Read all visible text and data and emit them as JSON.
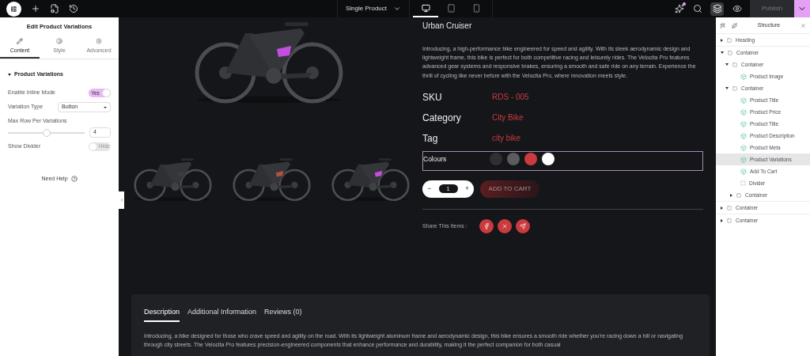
{
  "topbar": {
    "page_selector": "Single Product",
    "devices": [
      {
        "kind": "desktop",
        "selected": true
      },
      {
        "kind": "tablet",
        "selected": false
      },
      {
        "kind": "mobile",
        "selected": false
      }
    ],
    "publish": "Publish",
    "notification": true
  },
  "left_panel": {
    "title": "Edit Product Variations",
    "tabs": [
      {
        "label": "Content",
        "kind": "pencil",
        "selected": true
      },
      {
        "label": "Style",
        "kind": "contrast",
        "selected": false
      },
      {
        "label": "Advanced",
        "kind": "gear",
        "selected": false
      }
    ],
    "section": {
      "title": "Product Variations",
      "expanded": true
    },
    "controls": [
      {
        "kind": "switch",
        "label": "Enable Inline Mode",
        "on": true,
        "on_text": "Yes"
      },
      {
        "kind": "select",
        "label": "Variation Type",
        "value": "Button"
      },
      {
        "kind": "slider",
        "label": "Max Row Per Variations",
        "level": 0.5,
        "value": "4"
      },
      {
        "kind": "switch",
        "label": "Show Divider",
        "on": false,
        "off_text": "Hide"
      }
    ],
    "help": "Need Help"
  },
  "product": {
    "title": "Urban Cruiser",
    "description": "Introducing, a high-performance bike engineered for speed and agility. With its sleek aerodynamic design and lightweight frame, this bike is perfect for both competitive racing and leisurely rides. The Velocita Pro features advanced gear systems and responsive brakes, ensuring a smooth and safe ride on any terrain. Experience the thrill of cycling like never before with the Velocita Pro, where innovation meets style.",
    "meta": [
      {
        "label": "SKU",
        "value": "RDS - 005"
      },
      {
        "label": "Category",
        "value": "City Bike"
      },
      {
        "label": "Tag",
        "value": "city bike"
      }
    ],
    "colours": {
      "label": "Colours",
      "swatches": [
        {
          "color": "#2e3033"
        },
        {
          "color": "#5c5c5e"
        },
        {
          "color": "#c93b3e"
        },
        {
          "color": "#ffffff"
        }
      ]
    },
    "quantity": {
      "minus": "−",
      "value": "1",
      "plus": "+"
    },
    "add_to_cart": "ADD TO CART",
    "share": {
      "label": "Share This Items :",
      "networks": [
        {
          "kind": "facebook"
        },
        {
          "kind": "x"
        },
        {
          "kind": "telegram"
        }
      ]
    }
  },
  "info_tabs": {
    "tabs": [
      {
        "label": "Description",
        "selected": true
      },
      {
        "label": "Additional Information",
        "selected": false
      },
      {
        "label": "Reviews (0)",
        "selected": false
      }
    ],
    "text": "Introducing, a bike designed for those who crave speed and agility on the road. With its lightweight aluminum frame and aerodynamic design, this bike ensures a smooth ride whether you're racing down a hill or navigating through city streets. The Velocita Pro features precision-engineered components that enhance performance and durability, making it the perfect companion for both casual"
  },
  "structure": {
    "title": "Structure",
    "items": [
      {
        "label": "Heading",
        "kind": "container",
        "expanded": false,
        "selected": false
      },
      {
        "label": "Container",
        "kind": "container",
        "expanded": true,
        "selected": false,
        "children": [
          {
            "label": "Container",
            "kind": "container",
            "expanded": true,
            "selected": false,
            "children": [
              {
                "label": "Product Image",
                "kind": "widget",
                "selected": false
              }
            ]
          },
          {
            "label": "Container",
            "kind": "container",
            "expanded": true,
            "selected": false,
            "children": [
              {
                "label": "Product Title",
                "kind": "widget",
                "selected": false
              },
              {
                "label": "Product Price",
                "kind": "widget",
                "selected": false
              },
              {
                "label": "Product Title",
                "kind": "widget",
                "selected": false
              },
              {
                "label": "Product Description",
                "kind": "widget",
                "selected": false
              },
              {
                "label": "Product Meta",
                "kind": "widget",
                "selected": false
              },
              {
                "label": "Product Variations",
                "kind": "widget",
                "selected": true
              },
              {
                "label": "Add To Cart",
                "kind": "widget",
                "selected": false
              },
              {
                "label": "Divider",
                "kind": "divider",
                "selected": false
              },
              {
                "label": "Container",
                "kind": "container",
                "expanded": false,
                "selected": false
              }
            ]
          }
        ]
      },
      {
        "label": "Container",
        "kind": "container",
        "expanded": false,
        "selected": false
      },
      {
        "label": "Container",
        "kind": "container",
        "expanded": false,
        "selected": false
      }
    ]
  }
}
